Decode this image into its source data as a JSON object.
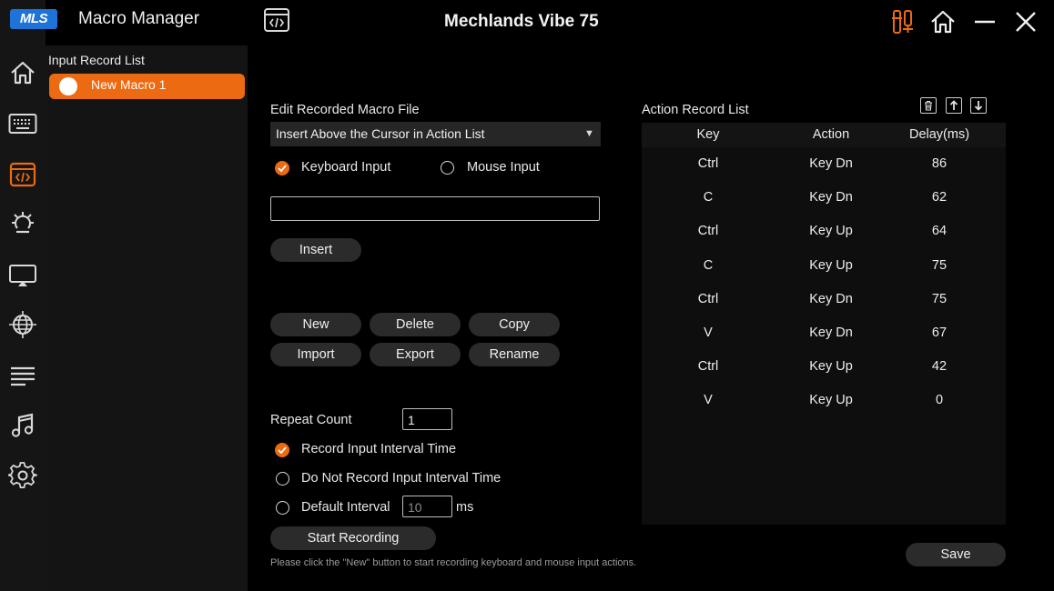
{
  "app": {
    "logo_text": "MLS",
    "title": "Macro Manager",
    "device_name": "Mechlands Vibe 75"
  },
  "rail": [
    "home-icon",
    "keyboard-icon",
    "macro-icon",
    "lighting-icon",
    "display-icon",
    "network-icon",
    "text-align-icon",
    "music-icon",
    "settings-icon"
  ],
  "input_record": {
    "title": "Input Record List",
    "items": [
      {
        "label": "New Macro 1",
        "selected": true
      }
    ]
  },
  "edit": {
    "title": "Edit Recorded Macro File",
    "insert_mode": "Insert Above the Cursor in Action List",
    "keyboard_input": "Keyboard Input",
    "mouse_input": "Mouse Input",
    "selected_input": "Keyboard Input",
    "key_value": "",
    "insert_label": "Insert"
  },
  "file_buttons": {
    "new": "New",
    "delete": "Delete",
    "copy": "Copy",
    "import": "Import",
    "export": "Export",
    "rename": "Rename"
  },
  "repeat": {
    "label": "Repeat Count",
    "value": "1",
    "opt_record": "Record Input Interval Time",
    "opt_no_record": "Do Not Record Input Interval Time",
    "opt_default": "Default Interval",
    "default_value": "10",
    "unit": "ms",
    "selected": "Record Input Interval Time"
  },
  "start_recording": "Start Recording",
  "hint": "Please click the \"New\" button to start recording keyboard and mouse input actions.",
  "action_list": {
    "title": "Action Record List",
    "columns": [
      "Key",
      "Action",
      "Delay(ms)"
    ],
    "rows": [
      [
        "Ctrl",
        "Key Dn",
        "86"
      ],
      [
        "C",
        "Key Dn",
        "62"
      ],
      [
        "Ctrl",
        "Key Up",
        "64"
      ],
      [
        "C",
        "Key Up",
        "75"
      ],
      [
        "Ctrl",
        "Key Dn",
        "75"
      ],
      [
        "V",
        "Key Dn",
        "67"
      ],
      [
        "Ctrl",
        "Key Up",
        "42"
      ],
      [
        "V",
        "Key Up",
        "0"
      ]
    ]
  },
  "save_label": "Save",
  "colors": {
    "accent": "#ec6a11",
    "logo_blue": "#1e73d8"
  }
}
